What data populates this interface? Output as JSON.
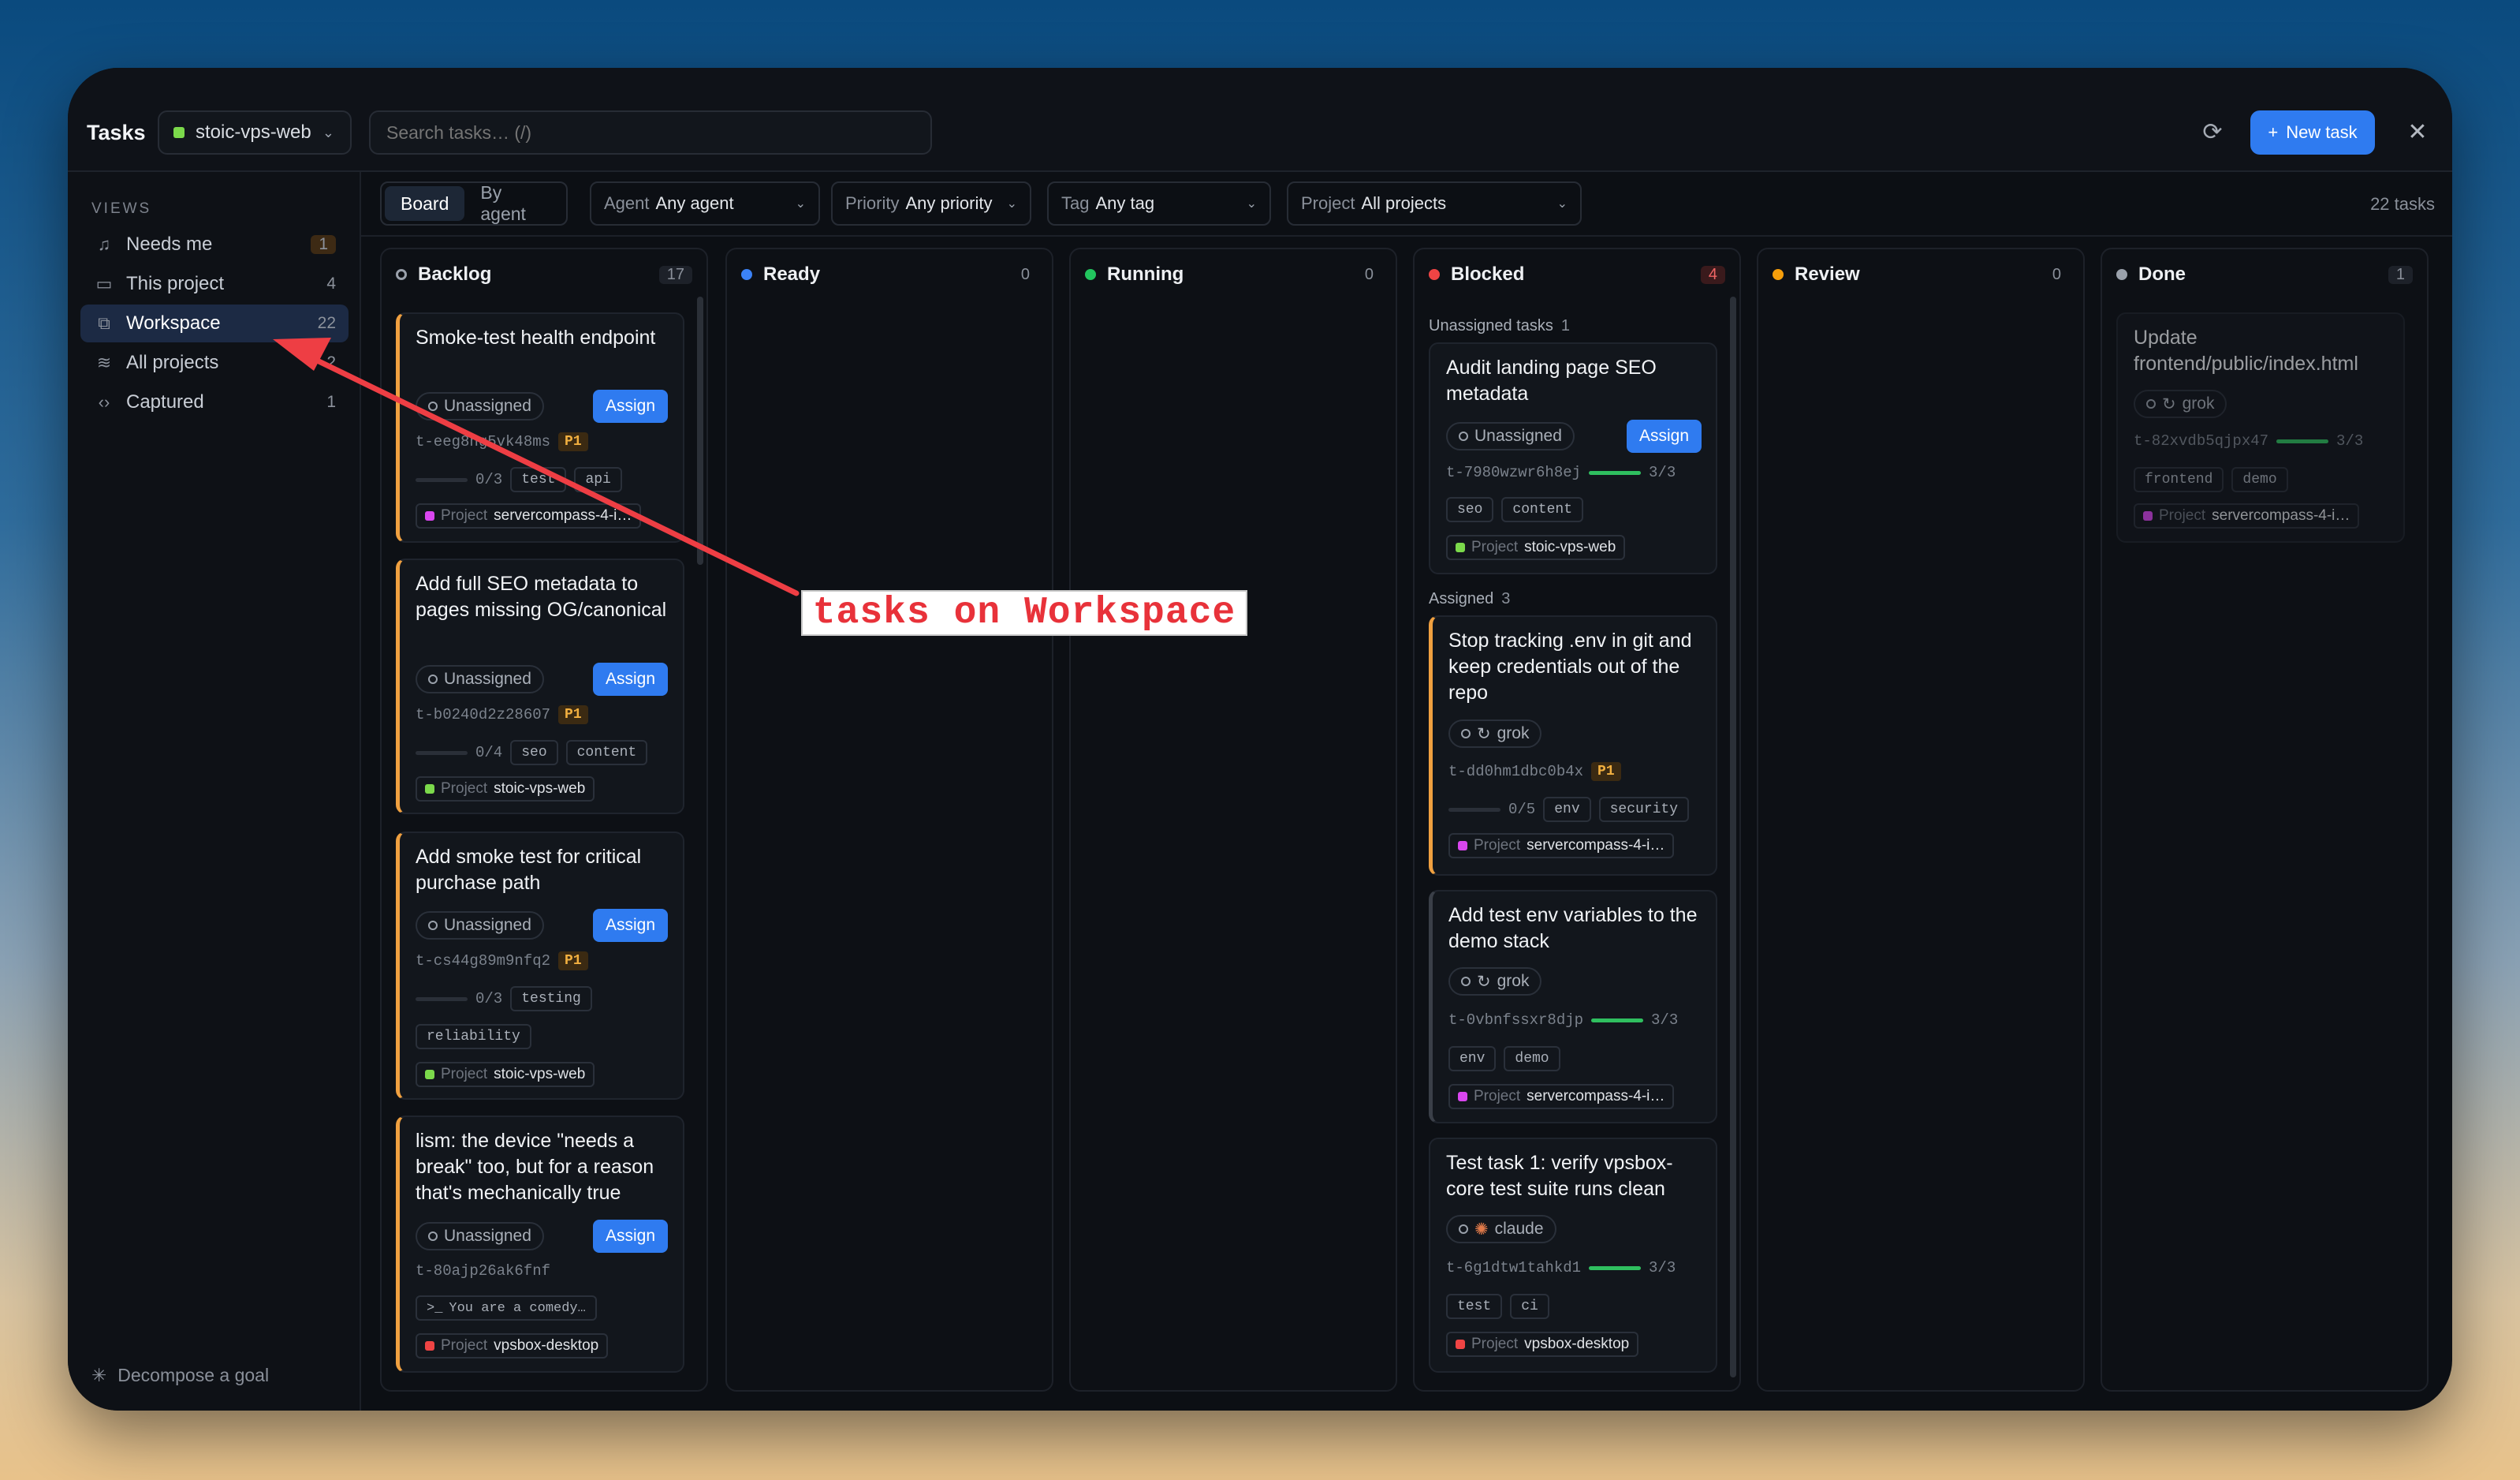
{
  "titlebar": {
    "title": "Tasks",
    "project": "stoic-vps-web",
    "search_placeholder": "Search tasks… (/)",
    "new_task": "New task"
  },
  "sidebar": {
    "views_heading": "VIEWS",
    "items": [
      {
        "label": "Needs me",
        "count": "1",
        "icon": "bell-icon"
      },
      {
        "label": "This project",
        "count": "4",
        "icon": "folder-icon"
      },
      {
        "label": "Workspace",
        "count": "22",
        "icon": "workspace-icon"
      },
      {
        "label": "All projects",
        "count": "2",
        "icon": "layers-icon"
      },
      {
        "label": "Captured",
        "count": "1",
        "icon": "code-icon"
      }
    ],
    "decompose": "Decompose a goal"
  },
  "filters": {
    "view_board": "Board",
    "view_agent": "By agent",
    "agent_label": "Agent",
    "agent_value": "Any agent",
    "priority_label": "Priority",
    "priority_value": "Any priority",
    "tag_label": "Tag",
    "tag_value": "Any tag",
    "project_label": "Project",
    "project_value": "All projects",
    "task_count": "22 tasks"
  },
  "columns": [
    {
      "name": "Backlog",
      "count": "17",
      "color": "#9aa1ab"
    },
    {
      "name": "Ready",
      "count": "0",
      "color": "#3b82f6"
    },
    {
      "name": "Running",
      "count": "0",
      "color": "#22c55e"
    },
    {
      "name": "Blocked",
      "count": "4",
      "color": "#ef4444"
    },
    {
      "name": "Review",
      "count": "0",
      "color": "#f59e0b"
    },
    {
      "name": "Done",
      "count": "1",
      "color": "#9aa1ab"
    }
  ],
  "common": {
    "unassigned": "Unassigned",
    "assign": "Assign",
    "project_prefix": "Project",
    "p1": "P1"
  },
  "backlog": [
    {
      "title": "Smoke-test health endpoint",
      "id": "t-eeg8hg5vk48ms",
      "progress": "0/3",
      "tags": [
        "test",
        "api"
      ],
      "project": "servercompass-4-i…",
      "project_color": "#d946ef"
    },
    {
      "title": "Add full SEO metadata to pages missing OG/canonical",
      "id": "t-b0240d2z28607",
      "progress": "0/4",
      "tags": [
        "seo",
        "content"
      ],
      "project": "stoic-vps-web",
      "project_color": "#7bd94b"
    },
    {
      "title": "Add smoke test for critical purchase path",
      "id": "t-cs44g89m9nfq2",
      "progress": "0/3",
      "tags": [
        "testing",
        "reliability"
      ],
      "project": "stoic-vps-web",
      "project_color": "#7bd94b"
    },
    {
      "title": "lism: the device \"needs a break\" too, but for a reason that's mechanically true",
      "id": "t-80ajp26ak6fnf",
      "prompt": "You are a comedy…",
      "project": "vpsbox-desktop",
      "project_color": "#ef4444"
    }
  ],
  "blocked": {
    "unassigned_heading": "Unassigned tasks",
    "unassigned_count": "1",
    "assigned_heading": "Assigned",
    "assigned_count": "3",
    "cards": [
      {
        "title": "Audit landing page SEO metadata",
        "id": "t-7980wzwr6h8ej",
        "progress": "3/3",
        "progress_value": 1,
        "tags": [
          "seo",
          "content"
        ],
        "project": "stoic-vps-web",
        "project_color": "#7bd94b"
      },
      {
        "title": "Stop tracking .env in git and keep credentials out of the repo",
        "agent": "grok",
        "id": "t-dd0hm1dbc0b4x",
        "progress": "0/5",
        "progress_value": 0,
        "tags": [
          "env",
          "security"
        ],
        "project": "servercompass-4-i…",
        "project_color": "#d946ef"
      },
      {
        "title": "Add test env variables to the demo stack",
        "agent": "grok",
        "id": "t-0vbnfssxr8djp",
        "progress": "3/3",
        "progress_value": 1,
        "tags": [
          "env",
          "demo"
        ],
        "project": "servercompass-4-i…",
        "project_color": "#d946ef"
      },
      {
        "title": "Test task 1: verify vpsbox-core test suite runs clean",
        "agent": "claude",
        "id": "t-6g1dtw1tahkd1",
        "progress": "3/3",
        "progress_value": 1,
        "tags": [
          "test",
          "ci"
        ],
        "project": "vpsbox-desktop",
        "project_color": "#ef4444"
      }
    ]
  },
  "done": [
    {
      "title": "Update frontend/public/index.html",
      "agent": "grok",
      "id": "t-82xvdb5qjpx47",
      "progress": "3/3",
      "progress_value": 1,
      "tags": [
        "frontend",
        "demo"
      ],
      "project": "servercompass-4-i…",
      "project_color": "#d946ef"
    }
  ],
  "annotation": {
    "text": "tasks on Workspace",
    "color": "#e8323a"
  }
}
